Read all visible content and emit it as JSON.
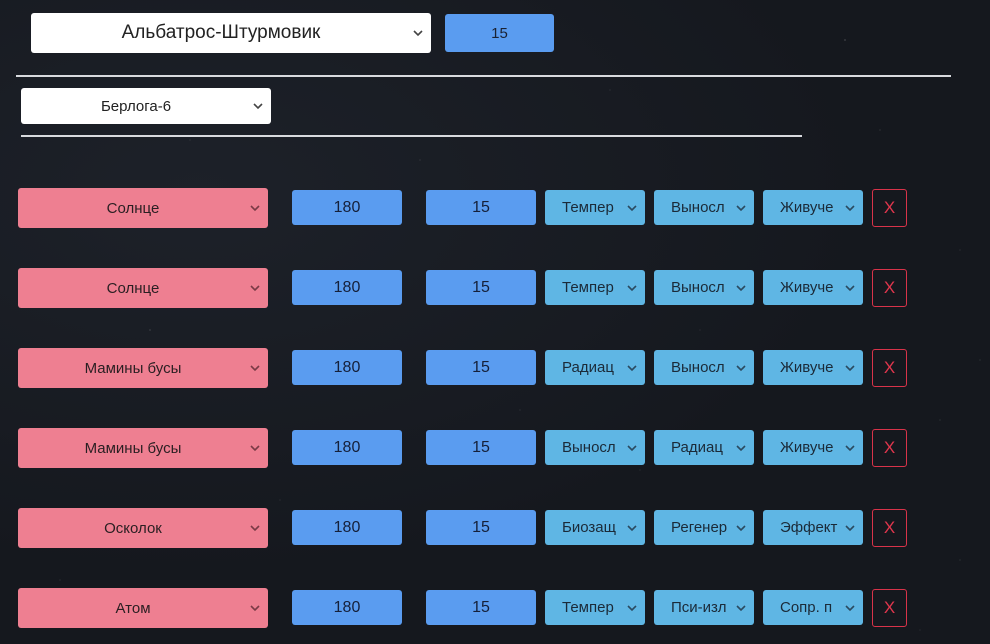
{
  "ship": {
    "selected": "Альбатрос-Штурмовик",
    "value": "15"
  },
  "base": {
    "selected": "Берлога-6"
  },
  "rows": [
    {
      "name": "Солнце",
      "value_a": "180",
      "value_b": "15",
      "stat_1": "Темпер",
      "stat_2": "Выносл",
      "stat_3": "Живуче",
      "delete_label": "X"
    },
    {
      "name": "Солнце",
      "value_a": "180",
      "value_b": "15",
      "stat_1": "Темпер",
      "stat_2": "Выносл",
      "stat_3": "Живуче",
      "delete_label": "X"
    },
    {
      "name": "Мамины бусы",
      "value_a": "180",
      "value_b": "15",
      "stat_1": "Радиац",
      "stat_2": "Выносл",
      "stat_3": "Живуче",
      "delete_label": "X"
    },
    {
      "name": "Мамины бусы",
      "value_a": "180",
      "value_b": "15",
      "stat_1": "Выносл",
      "stat_2": "Радиац",
      "stat_3": "Живуче",
      "delete_label": "X"
    },
    {
      "name": "Осколок",
      "value_a": "180",
      "value_b": "15",
      "stat_1": "Биозащ",
      "stat_2": "Регенер",
      "stat_3": "Эффект",
      "delete_label": "X"
    },
    {
      "name": "Атом",
      "value_a": "180",
      "value_b": "15",
      "stat_1": "Темпер",
      "stat_2": "Пси-изл",
      "stat_3": "Сопр. п",
      "delete_label": "X"
    }
  ],
  "icons": {
    "chevron": "chevron-down-icon"
  },
  "colors": {
    "name_select_bg": "#ee7f91",
    "number_bg": "#5a9cf0",
    "stat_select_bg": "#5fb6e4",
    "delete_accent": "#e0364d",
    "divider": "#d8dade"
  }
}
